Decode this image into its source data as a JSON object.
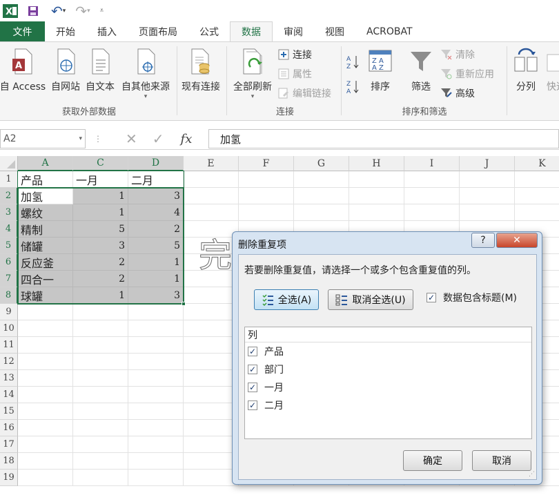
{
  "tabs": [
    "文件",
    "开始",
    "插入",
    "页面布局",
    "公式",
    "数据",
    "审阅",
    "视图",
    "ACROBAT"
  ],
  "ribbon": {
    "groups": {
      "external": {
        "label": "获取外部数据",
        "buttons": [
          "自 Access",
          "自网站",
          "自文本",
          "自其他来源",
          "现有连接"
        ]
      },
      "connections": {
        "label": "连接",
        "refresh_all": "全部刷新",
        "connections": "连接",
        "properties": "属性",
        "edit_links": "编辑链接"
      },
      "sort_filter": {
        "label": "排序和筛选",
        "sort": "排序",
        "filter": "筛选",
        "clear": "清除",
        "reapply": "重新应用",
        "advanced": "高级"
      },
      "tools": {
        "text_to_columns": "分列",
        "flash_fill": "快速"
      }
    }
  },
  "formula_bar": {
    "name_box": "A2",
    "fx": "fx",
    "content": "加氢"
  },
  "grid": {
    "columns": [
      "A",
      "C",
      "D",
      "E",
      "F",
      "G",
      "H",
      "I",
      "J",
      "K"
    ],
    "rows": [
      "1",
      "2",
      "3",
      "4",
      "5",
      "6",
      "7",
      "8",
      "9",
      "10",
      "11",
      "12",
      "13",
      "14",
      "15",
      "16",
      "17",
      "18",
      "19"
    ],
    "header_row": [
      "产品",
      "一月",
      "二月"
    ],
    "data": [
      [
        "加氢",
        "1",
        "3"
      ],
      [
        "螺纹",
        "1",
        "4"
      ],
      [
        "精制",
        "5",
        "2"
      ],
      [
        "储罐",
        "3",
        "5"
      ],
      [
        "反应釜",
        "2",
        "1"
      ],
      [
        "四合一",
        "2",
        "1"
      ],
      [
        "球罐",
        "1",
        "3"
      ]
    ]
  },
  "dialog": {
    "title": "删除重复项",
    "help": "?",
    "close": "✕",
    "instruction": "若要删除重复值，请选择一个或多个包含重复值的列。",
    "select_all": "全选(A)",
    "unselect_all": "取消全选(U)",
    "has_headers": "数据包含标题(M)",
    "list_header": "列",
    "columns": [
      "产品",
      "部门",
      "一月",
      "二月"
    ],
    "ok": "确定",
    "cancel": "取消"
  },
  "watermark": "完美下载",
  "colors": {
    "accent": "#217346",
    "selection": "#c6c6c6"
  }
}
